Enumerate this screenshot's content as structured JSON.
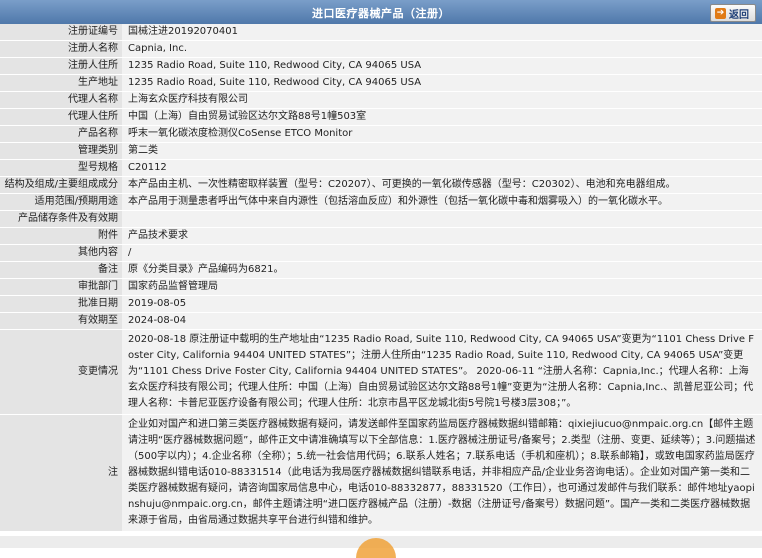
{
  "header": {
    "title": "进口医疗器械产品（注册）",
    "back_label": "返回"
  },
  "rows": [
    {
      "label": "注册证编号",
      "value": "国械注进20192070401"
    },
    {
      "label": "注册人名称",
      "value": "Capnia, Inc."
    },
    {
      "label": "注册人住所",
      "value": "1235 Radio Road, Suite 110, Redwood City, CA 94065 USA"
    },
    {
      "label": "生产地址",
      "value": "1235 Radio Road, Suite 110, Redwood City, CA 94065 USA"
    },
    {
      "label": "代理人名称",
      "value": "上海玄众医疗科技有限公司"
    },
    {
      "label": "代理人住所",
      "value": "中国（上海）自由贸易试验区达尔文路88号1幢503室"
    },
    {
      "label": "产品名称",
      "value": "呼末一氧化碳浓度检测仪CoSense ETCO Monitor"
    },
    {
      "label": "管理类别",
      "value": "第二类"
    },
    {
      "label": "型号规格",
      "value": "C20112"
    },
    {
      "label": "结构及组成/主要组成成分",
      "value": "本产品由主机、一次性精密取样装置（型号：C20207）、可更换的一氧化碳传感器（型号：C20302）、电池和充电器组成。"
    },
    {
      "label": "适用范围/预期用途",
      "value": "本产品用于测量患者呼出气体中来自内源性（包括溶血反应）和外源性（包括一氧化碳中毒和烟雾吸入）的一氧化碳水平。"
    },
    {
      "label": "产品储存条件及有效期",
      "value": ""
    },
    {
      "label": "附件",
      "value": "产品技术要求"
    },
    {
      "label": "其他内容",
      "value": "/"
    },
    {
      "label": "备注",
      "value": "原《分类目录》产品编码为6821。"
    },
    {
      "label": "审批部门",
      "value": "国家药品监督管理局"
    },
    {
      "label": "批准日期",
      "value": "2019-08-05"
    },
    {
      "label": "有效期至",
      "value": "2024-08-04"
    },
    {
      "label": "变更情况",
      "value": "2020-08-18 原注册证中载明的生产地址由“1235 Radio Road, Suite 110, Redwood City, CA 94065 USA”变更为“1101 Chess Drive Foster City, California 94404 UNITED STATES”；注册人住所由“1235 Radio Road, Suite 110, Redwood City, CA 94065 USA”变更为“1101 Chess Drive Foster City, California 94404 UNITED STATES”。 2020-06-11 “注册人名称：Capnia,Inc.；代理人名称：上海玄众医疗科技有限公司；代理人住所：中国（上海）自由贸易试验区达尔文路88号1幢”变更为“注册人名称：Capnia,Inc.、凯普尼亚公司；代理人名称：卡普尼亚医疗设备有限公司；代理人住所：北京市昌平区龙城北街5号院1号楼3层308；”。"
    },
    {
      "label": "注",
      "value": "企业如对国产和进口第三类医疗器械数据有疑问，请发送邮件至国家药监局医疗器械数据纠错邮箱：qixiejiucuo@nmpaic.org.cn【邮件主题请注明“医疗器械数据问题”，邮件正文中请准确填写以下全部信息：1.医疗器械注册证号/备案号；2.类型（注册、变更、延续等）；3.问题描述（500字以内）；4.企业名称（全称）；5.统一社会信用代码；6.联系人姓名；7.联系电话（手机和座机）；8.联系邮箱】，或致电国家药监局医疗器械数据纠错电话010-88331514（此电话为我局医疗器械数据纠错联系电话，并非相应产品/企业业务咨询电话）。企业如对国产第一类和二类医疗器械数据有疑问，请咨询国家局信息中心，电话010-88332877，88331520（工作日），也可通过发邮件与我们联系：邮件地址yaopinshuju@nmpaic.org.cn，邮件主题请注明“进口医疗器械产品（注册）-数据（注册证号/备案号）数据问题”。国产一类和二类医疗器械数据来源于省局，由省局通过数据共享平台进行纠错和维护。"
    }
  ]
}
